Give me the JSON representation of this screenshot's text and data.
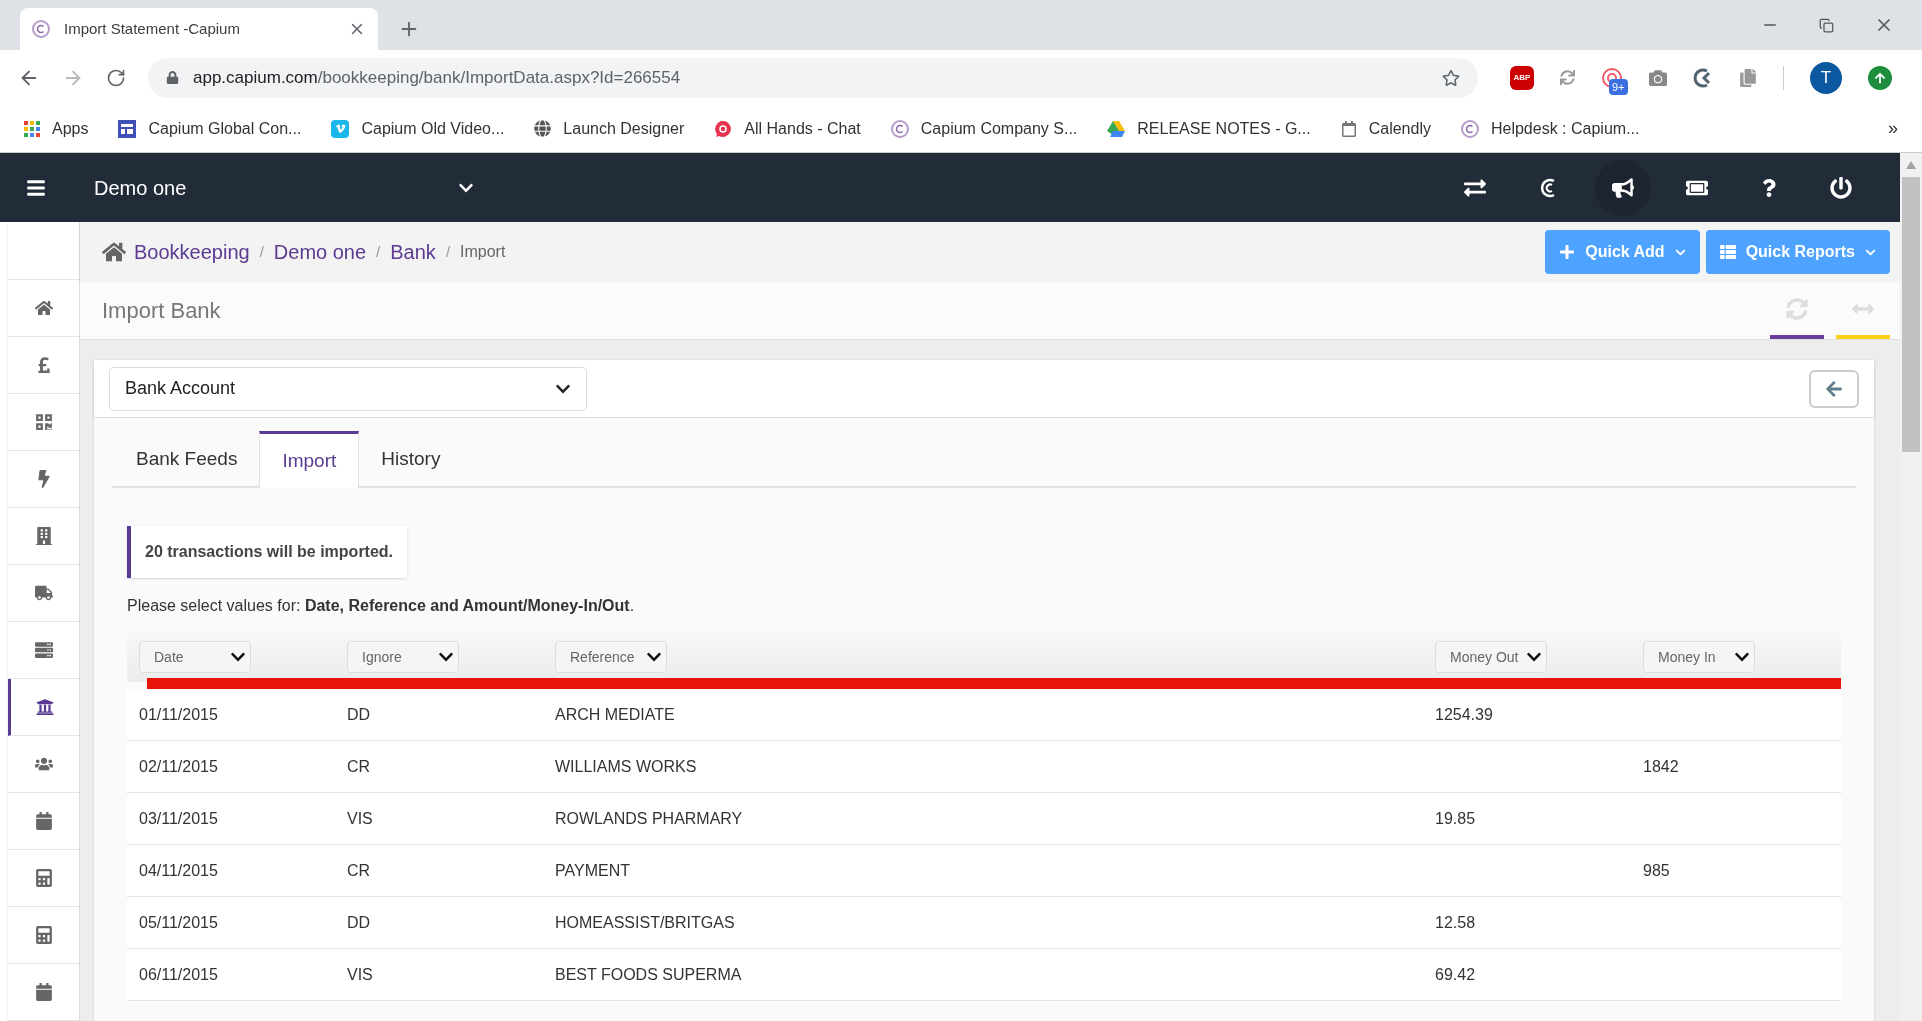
{
  "browser": {
    "tab_title": "Import Statement -Capium",
    "url_host": "app.capium.com",
    "url_path": "/bookkeeping/bank/ImportData.aspx?Id=266554",
    "extension_badge": "9+",
    "profile_initial": "T",
    "adblock_label": "ABP",
    "bookmarks": [
      "Apps",
      "Capium Global Con...",
      "Capium Old Video...",
      "Launch Designer",
      "All Hands - Chat",
      "Capium Company S...",
      "RELEASE NOTES - G...",
      "Calendly",
      "Helpdesk : Capium..."
    ],
    "bookmarks_more": "»"
  },
  "header": {
    "company": "Demo one"
  },
  "sidebar": {
    "items": [
      {
        "selected": false
      },
      {
        "selected": false
      },
      {
        "selected": false
      },
      {
        "selected": false
      },
      {
        "selected": false
      },
      {
        "selected": false
      },
      {
        "selected": false
      },
      {
        "selected": true
      },
      {
        "selected": false
      },
      {
        "selected": false
      },
      {
        "selected": false
      },
      {
        "selected": false
      },
      {
        "selected": false
      }
    ]
  },
  "breadcrumb": [
    {
      "label": "Bookkeeping",
      "link": true
    },
    {
      "separator": "/",
      "label": "Demo one",
      "link": true
    },
    {
      "separator": "/",
      "label": "Bank",
      "link": true
    },
    {
      "separator": "/",
      "label": "Import",
      "link": false
    }
  ],
  "quick_buttons": [
    "Quick Add",
    "Quick Reports"
  ],
  "page_title": "Import Bank",
  "bank_account": {
    "value": "Bank Account"
  },
  "tabs": [
    {
      "label": "Bank Feeds",
      "selected": false
    },
    {
      "label": "Import",
      "selected": true
    },
    {
      "label": "History",
      "selected": false
    }
  ],
  "notice": "20 transactions will be imported.",
  "instruction": "Please select values for: **Date, Reference and Amount/Money-In/Out**.",
  "table": {
    "columns": [
      {
        "label": "Date"
      },
      {
        "label": "Ignore"
      },
      {
        "label": "Reference"
      },
      {
        "label": "Money Out"
      },
      {
        "label": "Money In"
      }
    ],
    "rows": [
      {
        "date": "01/11/2015",
        "ignore": "DD",
        "reference": "ARCH MEDIATE",
        "money_out": "1254.39"
      },
      {
        "date": "02/11/2015",
        "ignore": "CR",
        "reference": "WILLIAMS WORKS",
        "money_in": "1842"
      },
      {
        "date": "03/11/2015",
        "ignore": "VIS",
        "reference": "ROWLANDS PHARMARY",
        "money_out": "19.85"
      },
      {
        "date": "04/11/2015",
        "ignore": "CR",
        "reference": "PAYMENT",
        "money_in": "985"
      },
      {
        "date": "05/11/2015",
        "ignore": "DD",
        "reference": "HOMEASSIST/BRITGAS",
        "money_out": "12.58"
      },
      {
        "date": "06/11/2015",
        "ignore": "VIS",
        "reference": "BEST FOODS SUPERMA",
        "money_out": "69.42"
      }
    ]
  }
}
